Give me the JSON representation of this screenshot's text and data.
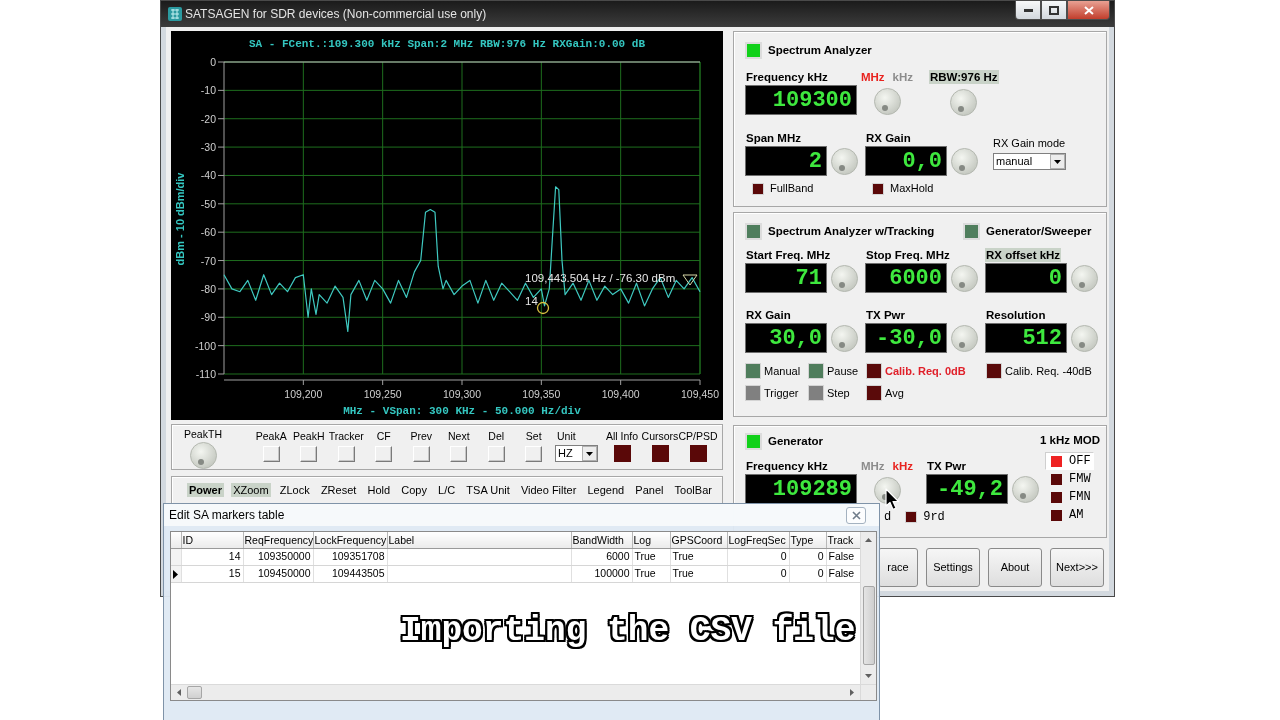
{
  "window": {
    "title": "SATSAGEN for SDR devices (Non-commercial use only)"
  },
  "spectrum": {
    "chart_data": {
      "type": "line",
      "title": "SA - FCent.:109.300 kHz Span:2 MHz RBW:976 Hz RXGain:0.00 dB",
      "xlabel": "MHz - VSpan: 300 KHz - 50.000 Hz/div",
      "ylabel": "dBm - 10 dBm/div",
      "xlim": [
        109150,
        109450
      ],
      "ylim": [
        -110,
        0
      ],
      "xticks": [
        {
          "value": 109200,
          "label": "109,200"
        },
        {
          "value": 109250,
          "label": "109,250"
        },
        {
          "value": 109300,
          "label": "109,300"
        },
        {
          "value": 109350,
          "label": "109,350"
        },
        {
          "value": 109400,
          "label": "109,400"
        },
        {
          "value": 109450,
          "label": "109,450"
        }
      ],
      "yticks": [
        0,
        -10,
        -20,
        -30,
        -40,
        -50,
        -60,
        -70,
        -80,
        -90,
        -100,
        -110
      ],
      "grid": true,
      "color": "#3fc9c1",
      "x": [
        109150,
        109155,
        109160,
        109165,
        109170,
        109175,
        109180,
        109185,
        109190,
        109195,
        109200,
        109203,
        109205,
        109208,
        109210,
        109215,
        109220,
        109225,
        109228,
        109230,
        109235,
        109240,
        109245,
        109250,
        109255,
        109260,
        109265,
        109270,
        109274,
        109277,
        109280,
        109283,
        109285,
        109288,
        109290,
        109295,
        109300,
        109305,
        109310,
        109315,
        109320,
        109325,
        109330,
        109335,
        109340,
        109345,
        109350,
        109352,
        109355,
        109357,
        109359,
        109361,
        109363,
        109365,
        109370,
        109375,
        109380,
        109385,
        109390,
        109395,
        109400,
        109405,
        109410,
        109415,
        109420,
        109425,
        109430,
        109435,
        109440,
        109445,
        109450
      ],
      "values": [
        -75,
        -80,
        -81,
        -77,
        -84,
        -75,
        -82,
        -78,
        -81,
        -76,
        -75,
        -90,
        -80,
        -89,
        -82,
        -85,
        -79,
        -83,
        -95,
        -82,
        -77,
        -84,
        -77,
        -80,
        -85,
        -77,
        -83,
        -74,
        -70,
        -53,
        -52,
        -53,
        -72,
        -80,
        -77,
        -82,
        -79,
        -77,
        -85,
        -77,
        -84,
        -78,
        -81,
        -84,
        -78,
        -83,
        -80,
        -86,
        -80,
        -62,
        -44,
        -45,
        -70,
        -82,
        -78,
        -84,
        -77,
        -84,
        -79,
        -82,
        -80,
        -85,
        -78,
        -86,
        -80,
        -76,
        -83,
        -77,
        -80,
        -76,
        -81
      ],
      "annotations": [
        "109,443.504 Hz / -76.30 dBm",
        "14"
      ]
    }
  },
  "toolbar": {
    "threshold": {
      "label": "PeakTH"
    },
    "buttons": [
      "PeakA",
      "PeakH",
      "Tracker",
      "CF",
      "Prev",
      "Next",
      "Del",
      "Set"
    ],
    "unit": {
      "label": "Unit",
      "value": "HZ"
    },
    "indicators": [
      {
        "label": "All Info",
        "on": false
      },
      {
        "label": "Cursors",
        "on": false
      },
      {
        "label": "CP/PSD",
        "on": false
      }
    ]
  },
  "options_bar": [
    {
      "label": "Power",
      "highlighted": true,
      "bold": true
    },
    {
      "label": "XZoom",
      "highlighted": true,
      "bold": false
    },
    {
      "label": "ZLock",
      "highlighted": false,
      "bold": false
    },
    {
      "label": "ZReset",
      "highlighted": false,
      "bold": false
    },
    {
      "label": "Hold",
      "highlighted": false,
      "bold": false
    },
    {
      "label": "Copy",
      "highlighted": false,
      "bold": false
    },
    {
      "label": "L/C",
      "highlighted": false,
      "bold": false
    },
    {
      "label": "TSA Unit",
      "highlighted": false,
      "bold": false
    },
    {
      "label": "Video Filter",
      "highlighted": false,
      "bold": false
    },
    {
      "label": "Legend",
      "highlighted": false,
      "bold": false
    },
    {
      "label": "Panel",
      "highlighted": false,
      "bold": false
    },
    {
      "label": "ToolBar",
      "highlighted": false,
      "bold": false
    }
  ],
  "spectrum_analyzer": {
    "title": "Spectrum Analyzer",
    "on": true,
    "frequency": {
      "label": "Frequency kHz",
      "value": "109300"
    },
    "units": [
      {
        "label": "MHz",
        "selected": true
      },
      {
        "label": "kHz",
        "selected": false
      }
    ],
    "rbw": {
      "label": "RBW:976 Hz",
      "highlighted": true
    },
    "fields": [
      {
        "label": "Span MHz",
        "value": "2"
      },
      {
        "label": "RX Gain",
        "value": "0,0"
      }
    ],
    "gain_mode": {
      "label": "RX Gain mode",
      "value": "manual"
    },
    "toggles": [
      {
        "label": "FullBand",
        "on": false
      },
      {
        "label": "MaxHold",
        "on": false
      }
    ]
  },
  "tracking": {
    "modes": [
      {
        "label": "Spectrum Analyzer w/Tracking",
        "on": false
      },
      {
        "label": "Generator/Sweeper",
        "on": false
      }
    ],
    "fields": [
      {
        "label": "Start Freq. MHz",
        "value": "71",
        "highlighted": false
      },
      {
        "label": "Stop Freq. MHz",
        "value": "6000",
        "highlighted": false
      },
      {
        "label": "RX offset kHz",
        "value": "0",
        "highlighted": true
      },
      {
        "label": "RX Gain",
        "value": "30,0",
        "highlighted": false
      },
      {
        "label": "TX Pwr",
        "value": "-30,0",
        "highlighted": false
      },
      {
        "label": "Resolution",
        "value": "512",
        "highlighted": false
      }
    ],
    "toggles": [
      {
        "label": "Manual",
        "color": "#4f7d5c",
        "alert": false
      },
      {
        "label": "Pause",
        "color": "#4f7d5c",
        "alert": false
      },
      {
        "label": "Calib. Req. 0dB",
        "color": "#5a0a0a",
        "alert": true
      },
      {
        "label": "Calib. Req. -40dB",
        "color": "#5a0a0a",
        "alert": false
      },
      {
        "label": "Trigger",
        "color": "#808080",
        "alert": false
      },
      {
        "label": "Step",
        "color": "#808080",
        "alert": false
      },
      {
        "label": "Avg",
        "color": "#5a0a0a",
        "alert": false
      }
    ]
  },
  "generator": {
    "title": "Generator",
    "on": true,
    "frequency": {
      "label": "Frequency kHz",
      "value": "109289"
    },
    "units": [
      {
        "label": "MHz",
        "selected": false
      },
      {
        "label": "kHz",
        "selected": true
      }
    ],
    "tx_power": {
      "label": "TX Pwr",
      "value": "-49,2"
    },
    "fragment": "d",
    "toggles": [
      {
        "label": "9rd",
        "on": false
      }
    ],
    "modulation": {
      "title": "1 kHz MOD",
      "options": [
        {
          "label": "OFF",
          "selected": true
        },
        {
          "label": "FMW",
          "selected": false
        },
        {
          "label": "FMN",
          "selected": false
        },
        {
          "label": "AM",
          "selected": false
        }
      ]
    }
  },
  "buttons": [
    "race",
    "Settings",
    "About",
    "Next>>>"
  ],
  "markers_dialog": {
    "title": "Edit SA markers table",
    "columns": [
      "ID",
      "ReqFrequency",
      "LockFrequency",
      "Label",
      "BandWidth",
      "Log",
      "GPSCoord",
      "LogFreqSec",
      "Type",
      "Track"
    ],
    "rows": [
      {
        "selected": false,
        "cells": [
          "14",
          "109350000",
          "109351708",
          null,
          "6000",
          "True",
          "True",
          "0",
          "0",
          "False"
        ]
      },
      {
        "selected": true,
        "cells": [
          "15",
          "109450000",
          "109443505",
          null,
          "100000",
          "True",
          "True",
          "0",
          "0",
          "False"
        ]
      }
    ]
  },
  "caption": "Importing the CSV file"
}
